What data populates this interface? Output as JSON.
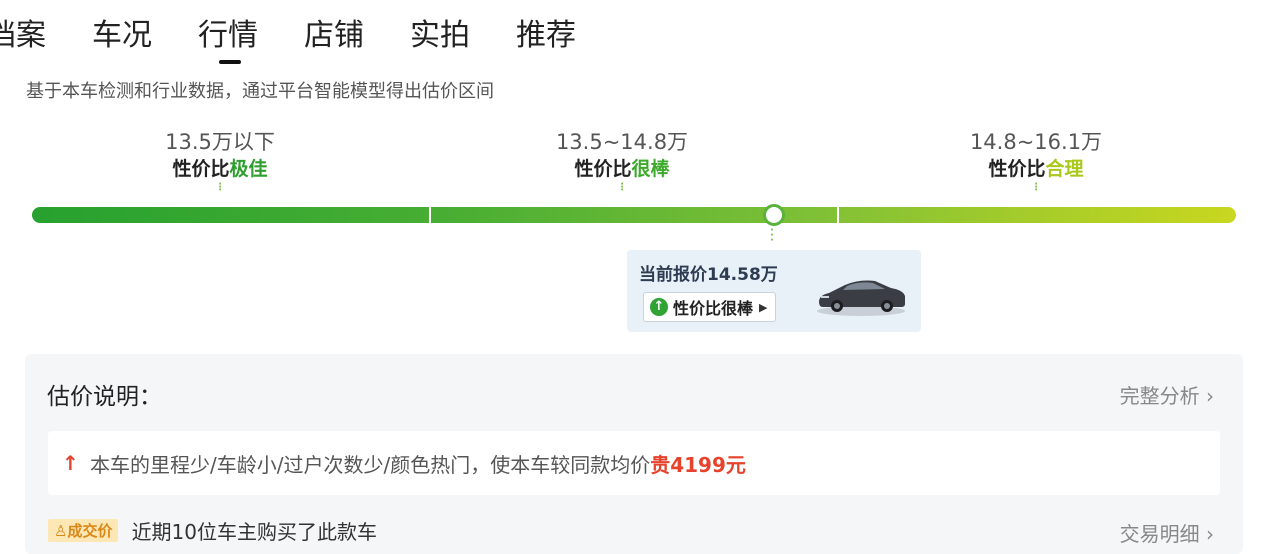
{
  "tabs": [
    {
      "label": "档案"
    },
    {
      "label": "车况"
    },
    {
      "label": "行情"
    },
    {
      "label": "店铺"
    },
    {
      "label": "实拍"
    },
    {
      "label": "推荐"
    }
  ],
  "active_tab": "行情",
  "subtitle": "基于本车检测和行业数据，通过平台智能模型得出估价区间",
  "ranges": [
    {
      "value": "13.5万以下",
      "prefix": "性价比",
      "rating": "极佳",
      "color": "#2f9e2f"
    },
    {
      "value": "13.5~14.8万",
      "prefix": "性价比",
      "rating": "很棒",
      "color": "#3eaa2c"
    },
    {
      "value": "14.8~16.1万",
      "prefix": "性价比",
      "rating": "合理",
      "color": "#a9c81a"
    }
  ],
  "current_price": {
    "title": "当前报价14.58万",
    "badge": "性价比很棒",
    "position_fraction": 0.615
  },
  "explanation": {
    "title": "估价说明：",
    "full_analysis": "完整分析 ›",
    "reason_text": "本车的里程少/车龄小/过户次数少/颜色热门，使本车较同款均价",
    "reason_dir": "贵",
    "reason_amount": "4199元",
    "deal_tag": "成交价",
    "deal_text": "近期10位车主购买了此款车",
    "deal_link": "交易明细 ›"
  },
  "colors": {
    "accent_green": "#2fa334",
    "price_up_red": "#e6422c",
    "card_bg": "#e8f1f8"
  }
}
